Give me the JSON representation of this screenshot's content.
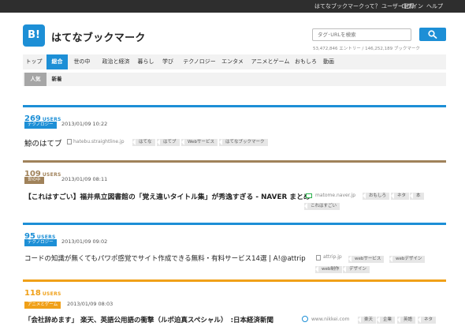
{
  "topnav": {
    "about": "はてなブックマークって？",
    "register": "ユーザー登録",
    "login": "ログイン",
    "help": "ヘルプ"
  },
  "header": {
    "logo_text": "B!",
    "site_title": "はてなブックマーク",
    "search_placeholder": "タグ･URLを検索",
    "stats": "53,472,846 エントリー / 146,252,189 ブックマーク"
  },
  "icons": {
    "logo": "hatena-bookmark-logo",
    "search": "search-icon",
    "favicon": "page-favicon-icon"
  },
  "colors": {
    "brand": "#1d8fd6",
    "technology": "#1d8fd6",
    "society": "#a0825a",
    "entertainment": "#f0a018",
    "tab_active": "#1d8fd6"
  },
  "main_tabs": [
    "トップ",
    "総合",
    "世の中",
    "政治と経済",
    "暮らし",
    "学び",
    "テクノロジー",
    "エンタメ",
    "アニメとゲーム",
    "おもしろ",
    "動画"
  ],
  "main_tab_active": "総合",
  "sub_tabs": [
    "人気",
    "新着"
  ],
  "sub_tab_active": "人気",
  "entries": [
    {
      "users": "269",
      "users_label": "USERS",
      "category": "テクノロジー",
      "date": "2013/01/09 10:22",
      "title": "鯨のはてブ",
      "domain": "hatebu.straightline.jp",
      "tags": [
        "はてな",
        "はてブ",
        "Webサービス",
        "はてなブックマーク"
      ]
    },
    {
      "users": "109",
      "users_label": "USERS",
      "category": "世の中",
      "date": "2013/01/09 08:11",
      "title": "【これはすごい】福井県立図書館の「覚え違いタイトル集」が秀逸すぎる - NAVER まとめ",
      "domain": "matome.naver.jp",
      "tags": [
        "おもしろ",
        "ネタ",
        "本",
        "これはすごい"
      ]
    },
    {
      "users": "95",
      "users_label": "USERS",
      "category": "テクノロジー",
      "date": "2013/01/09 09:02",
      "title": "コードの知識が無くてもパワポ感覚でサイト作成できる無料・有料サービス14選 | A!@attrip",
      "domain": "attrip.jp",
      "tags": [
        "webサービス",
        "webデザイン",
        "web制作",
        "デザイン"
      ]
    },
    {
      "users": "118",
      "users_label": "USERS",
      "category": "アニメとゲーム",
      "date": "2013/01/09 08:03",
      "title": "「会社辞めます」 楽天、英語公用語の衝撃（ルポ迫真スペシャル）　:日本経済新聞",
      "domain": "www.nikkei.com",
      "tags": [
        "楽天",
        "企業",
        "英語",
        "ネタ"
      ]
    }
  ]
}
